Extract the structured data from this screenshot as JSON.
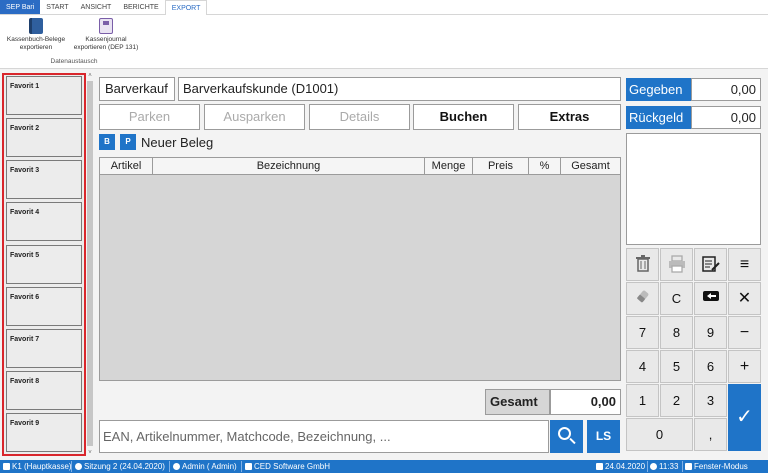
{
  "ribbon": {
    "tabs": [
      "SEP Bari",
      "START",
      "ANSICHT",
      "BERICHTE",
      "EXPORT"
    ],
    "buttons": [
      {
        "line1": "Kassenbuch-Belege",
        "line2": "exportieren"
      },
      {
        "line1": "Kassenjournal",
        "line2": "exportieren (DEP 131)"
      }
    ],
    "group_label": "Datenaustausch"
  },
  "favorites": [
    "Favorit 1",
    "Favorit 2",
    "Favorit 3",
    "Favorit 4",
    "Favorit 5",
    "Favorit 6",
    "Favorit 7",
    "Favorit 8",
    "Favorit 9"
  ],
  "customer": {
    "type": "Barverkauf",
    "name": "Barverkaufskunde (D1001)"
  },
  "actions": {
    "parken": "Parken",
    "ausparken": "Ausparken",
    "details": "Details",
    "buchen": "Buchen",
    "extras": "Extras"
  },
  "beleg": {
    "badge_b": "B",
    "badge_p": "P",
    "title": "Neuer Beleg"
  },
  "table": {
    "columns": [
      "Artikel",
      "Bezeichnung",
      "Menge",
      "Preis",
      "%",
      "Gesamt"
    ],
    "rows": []
  },
  "totals": {
    "gesamt_label": "Gesamt",
    "gesamt_value": "0,00"
  },
  "search": {
    "placeholder": "EAN, Artikelnummer, Matchcode, Bezeichnung, ...",
    "ls_label": "LS"
  },
  "payment": {
    "gegeben_label": "Gegeben",
    "gegeben_value": "0,00",
    "rueckgeld_label": "Rückgeld",
    "rueckgeld_value": "0,00"
  },
  "keypad": {
    "clear": "C",
    "minus": "−",
    "plus": "+",
    "close": "✕",
    "menu": "≡",
    "ok": "✓",
    "d7": "7",
    "d8": "8",
    "d9": "9",
    "d4": "4",
    "d5": "5",
    "d6": "6",
    "d1": "1",
    "d2": "2",
    "d3": "3",
    "d0": "0",
    "comma": ","
  },
  "status": {
    "register": "K1 (Hauptkasse)",
    "session": "Sitzung 2 (24.04.2020)",
    "user": "Admin ( Admin)",
    "company": "CED Software GmbH",
    "date": "24.04.2020",
    "time": "11:33",
    "mode": "Fenster-Modus"
  },
  "colors": {
    "accent": "#1f74c8",
    "favorites_border": "#d9262c"
  }
}
